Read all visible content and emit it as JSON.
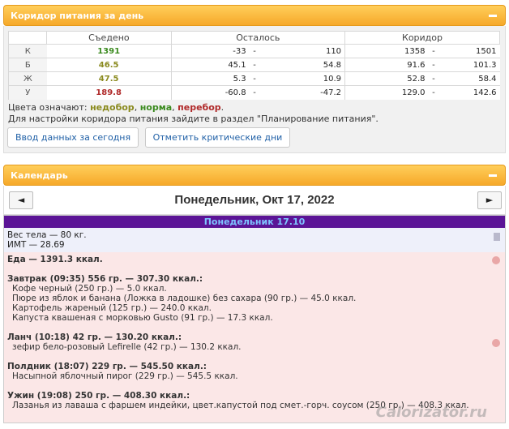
{
  "corridor_widget": {
    "title": "Коридор питания за день",
    "headers": [
      "Съедено",
      "Осталось",
      "Коридор"
    ],
    "rows": [
      {
        "label": "К",
        "eaten": "1391",
        "status": "ok",
        "left_min": "-33",
        "left_max": "110",
        "cor_min": "1358",
        "cor_max": "1501"
      },
      {
        "label": "Б",
        "eaten": "46.5",
        "status": "low",
        "left_min": "45.1",
        "left_max": "54.8",
        "cor_min": "91.6",
        "cor_max": "101.3"
      },
      {
        "label": "Ж",
        "eaten": "47.5",
        "status": "low",
        "left_min": "5.3",
        "left_max": "10.9",
        "cor_min": "52.8",
        "cor_max": "58.4"
      },
      {
        "label": "У",
        "eaten": "189.8",
        "status": "over",
        "left_min": "-60.8",
        "left_max": "-47.2",
        "cor_min": "129.0",
        "cor_max": "142.6"
      }
    ],
    "legend_prefix": "Цвета означают:",
    "legend_low": "недобор",
    "legend_ok": "норма",
    "legend_over": "перебор",
    "hint": "Для настройки коридора питания зайдите в раздел \"Планирование питания\".",
    "btn_enter": "Ввод данных за сегодня",
    "btn_critical": "Отметить критические дни",
    "dash": "-"
  },
  "calendar_widget": {
    "title": "Календарь",
    "prev_label": "◄",
    "next_label": "►",
    "date_title": "Понедельник, Окт 17, 2022",
    "day_header": "Понедельник 17.10",
    "weight_line": "Вес тела — 80 кг.",
    "bmi_line": "ИМТ — 28.69",
    "food_total": "Еда — 1391.3 ккал.",
    "meals": [
      {
        "title": "Завтрак (09:35) 556 гр. — 307.30 ккал.:",
        "items": [
          "Кофе черный (250 гр.) — 5.0 ккал.",
          "Пюре из яблок и банана (Ложка в ладошке) без сахара (90 гр.) — 45.0 ккал.",
          "Картофель жареный (125 гр.) — 240.0 ккал.",
          "Капуста квашеная с морковью Gusto (91 гр.) — 17.3 ккал."
        ]
      },
      {
        "title": "Ланч (10:18) 42 гр. — 130.20 ккал.:",
        "items": [
          "зефир бело-розовый Lefirelle (42 гр.) — 130.2 ккал."
        ]
      },
      {
        "title": "Полдник (18:07) 229 гр. — 545.50 ккал.:",
        "items": [
          "Насыпной яблочный пирог (229 гр.) — 545.5 ккал."
        ]
      },
      {
        "title": "Ужин (19:08) 250 гр. — 408.30 ккал.:",
        "items": [
          "Лазанья из лаваша с фаршем индейки, цвет.капустой под смет.-горч. соусом (250 гр.) — 408.3 ккал."
        ]
      }
    ],
    "watermark": "Calorizator.ru"
  }
}
